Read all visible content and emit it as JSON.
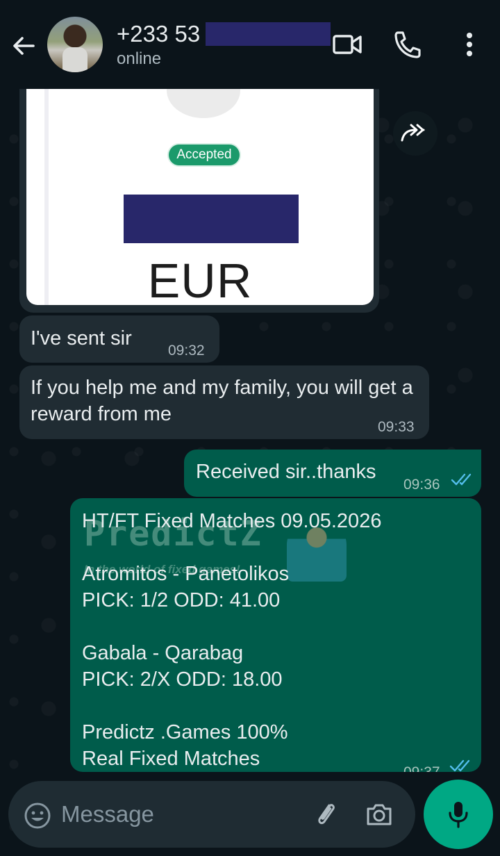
{
  "header": {
    "contact_name": "+233 53",
    "status": "online"
  },
  "image_message": {
    "badge": "Accepted",
    "currency": "EUR"
  },
  "messages": [
    {
      "direction": "in",
      "text": "I've sent sir",
      "time": "09:32"
    },
    {
      "direction": "in",
      "text": "If you help me and my family, you will get a reward from me",
      "time": "09:33"
    },
    {
      "direction": "out",
      "text": "Received sir..thanks",
      "time": "09:36"
    },
    {
      "direction": "out",
      "time": "09:37",
      "lines": [
        "HT/FT Fixed Matches 09.05.2026",
        "Atromitos - Panetolikos",
        "PICK: 1/2 ODD: 41.00",
        "Gabala - Qarabag",
        "PICK: 2/X  ODD: 18.00",
        "Predictz .Games 100%",
        "Real Fixed Matches"
      ],
      "watermark": {
        "logo": "PredictZ",
        "tagline": "In the world of fixed games!"
      }
    }
  ],
  "composer": {
    "placeholder": "Message"
  },
  "colors": {
    "background": "#0b141a",
    "incoming_bubble": "#202c33",
    "outgoing_bubble": "#005c4b",
    "accent": "#00a884",
    "read_ticks": "#53bdeb"
  },
  "icons": [
    "back-arrow-icon",
    "video-call-icon",
    "phone-icon",
    "more-options-icon",
    "forward-icon",
    "emoji-icon",
    "attach-icon",
    "camera-icon",
    "mic-icon",
    "double-check-icon"
  ]
}
